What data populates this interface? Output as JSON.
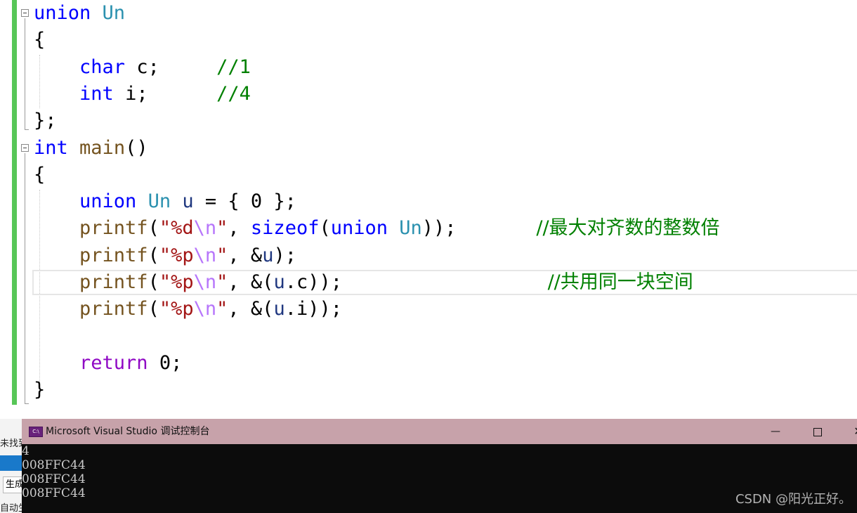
{
  "editor": {
    "code_lines": [
      [
        {
          "t": "union",
          "c": "kw"
        },
        {
          "t": " "
        },
        {
          "t": "Un",
          "c": "typ"
        }
      ],
      [
        {
          "t": "{"
        }
      ],
      [
        {
          "t": "    "
        },
        {
          "t": "char",
          "c": "kw"
        },
        {
          "t": " c;     "
        },
        {
          "t": "//1",
          "c": "cmt"
        }
      ],
      [
        {
          "t": "    "
        },
        {
          "t": "int",
          "c": "kw"
        },
        {
          "t": " i;      "
        },
        {
          "t": "//4",
          "c": "cmt"
        }
      ],
      [
        {
          "t": "};"
        }
      ],
      [
        {
          "t": "int",
          "c": "kw"
        },
        {
          "t": " "
        },
        {
          "t": "main",
          "c": "fn"
        },
        {
          "t": "()"
        }
      ],
      [
        {
          "t": "{"
        }
      ],
      [
        {
          "t": "    "
        },
        {
          "t": "union",
          "c": "kw"
        },
        {
          "t": " "
        },
        {
          "t": "Un",
          "c": "typ"
        },
        {
          "t": " "
        },
        {
          "t": "u",
          "c": "var"
        },
        {
          "t": " = { 0 };"
        }
      ],
      [
        {
          "t": "    "
        },
        {
          "t": "printf",
          "c": "fn"
        },
        {
          "t": "("
        },
        {
          "t": "\"%d",
          "c": "str"
        },
        {
          "t": "\\n",
          "c": "esc"
        },
        {
          "t": "\"",
          "c": "str"
        },
        {
          "t": ", "
        },
        {
          "t": "sizeof",
          "c": "kw"
        },
        {
          "t": "("
        },
        {
          "t": "union",
          "c": "kw"
        },
        {
          "t": " "
        },
        {
          "t": "Un",
          "c": "typ"
        },
        {
          "t": "));       "
        },
        {
          "t": "//最大对齐数的整数倍",
          "c": "cmt cmt-cjk"
        }
      ],
      [
        {
          "t": "    "
        },
        {
          "t": "printf",
          "c": "fn"
        },
        {
          "t": "("
        },
        {
          "t": "\"%p",
          "c": "str"
        },
        {
          "t": "\\n",
          "c": "esc"
        },
        {
          "t": "\"",
          "c": "str"
        },
        {
          "t": ", &"
        },
        {
          "t": "u",
          "c": "var"
        },
        {
          "t": ");"
        }
      ],
      [
        {
          "t": "    "
        },
        {
          "t": "printf",
          "c": "fn"
        },
        {
          "t": "("
        },
        {
          "t": "\"%p",
          "c": "str"
        },
        {
          "t": "\\n",
          "c": "esc"
        },
        {
          "t": "\"",
          "c": "str"
        },
        {
          "t": ", &("
        },
        {
          "t": "u",
          "c": "var"
        },
        {
          "t": ".c));                  "
        },
        {
          "t": "//共用同一块空间",
          "c": "cmt cmt-cjk"
        }
      ],
      [
        {
          "t": "    "
        },
        {
          "t": "printf",
          "c": "fn"
        },
        {
          "t": "("
        },
        {
          "t": "\"%p",
          "c": "str"
        },
        {
          "t": "\\n",
          "c": "esc"
        },
        {
          "t": "\"",
          "c": "str"
        },
        {
          "t": ", &("
        },
        {
          "t": "u",
          "c": "var"
        },
        {
          "t": ".i));"
        }
      ],
      [],
      [
        {
          "t": "    "
        },
        {
          "t": "return",
          "c": "ctl"
        },
        {
          "t": " 0;"
        }
      ],
      [
        {
          "t": "}"
        }
      ]
    ]
  },
  "left_panel": {
    "label_top": "未找到",
    "button_label": "生成",
    "label_bottom": "自动生成"
  },
  "console": {
    "title": "Microsoft Visual Studio 调试控制台",
    "app_icon": "C:\\",
    "minimize_glyph": "—",
    "close_glyph": "✕",
    "output_lines": [
      "4",
      "008FFC44",
      "008FFC44",
      "008FFC44"
    ],
    "watermark": "CSDN @阳光正好。"
  }
}
